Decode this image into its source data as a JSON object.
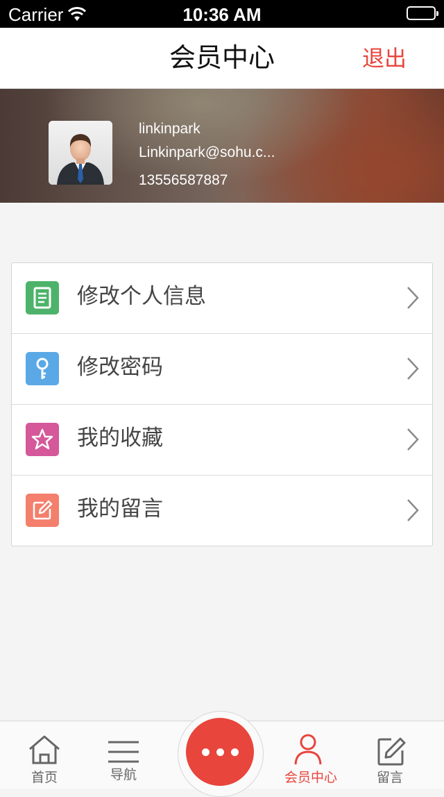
{
  "status_bar": {
    "carrier": "Carrier",
    "time": "10:36 AM"
  },
  "nav": {
    "title": "会员中心",
    "logout_label": "退出"
  },
  "profile": {
    "username": "linkinpark",
    "email": "Linkinpark@sohu.c...",
    "phone": "13556587887"
  },
  "menu": {
    "items": [
      {
        "label": "修改个人信息",
        "icon": "document-icon",
        "color": "#4db36a"
      },
      {
        "label": "修改密码",
        "icon": "key-icon",
        "color": "#5aa9e6"
      },
      {
        "label": "我的收藏",
        "icon": "star-icon",
        "color": "#d4589a"
      },
      {
        "label": "我的留言",
        "icon": "edit-icon",
        "color": "#f47f6c"
      }
    ]
  },
  "tab_bar": {
    "items": [
      {
        "label": "首页",
        "icon": "home-icon"
      },
      {
        "label": "导航",
        "icon": "menu-icon"
      },
      {
        "label": "会员中心",
        "icon": "user-icon",
        "active": true
      },
      {
        "label": "留言",
        "icon": "edit-icon"
      }
    ],
    "center_button_icon": "more-icon"
  },
  "colors": {
    "accent": "#e8453c",
    "background": "#f4f4f4"
  }
}
